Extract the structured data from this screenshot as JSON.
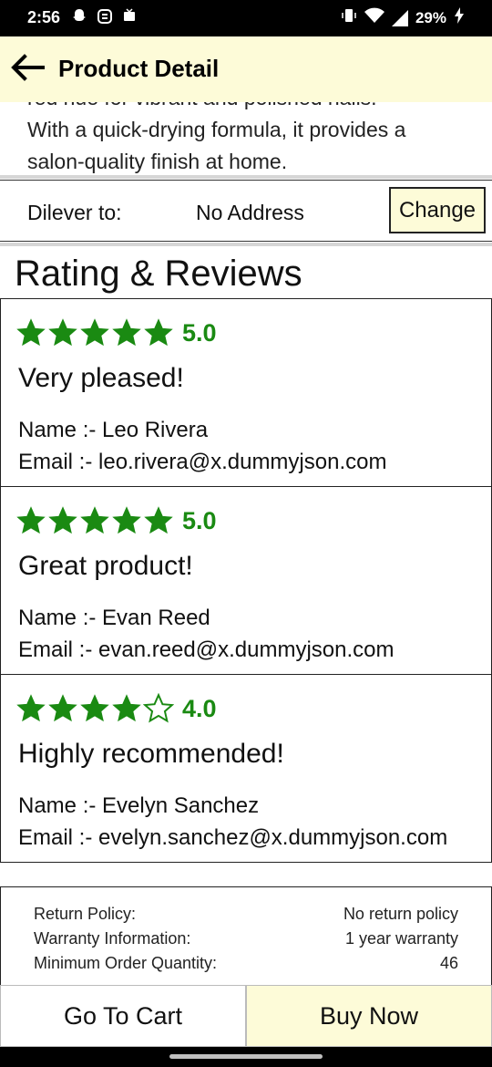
{
  "status_bar": {
    "time": "2:56",
    "battery": "29%",
    "left_icons": [
      "snapchat-icon",
      "app-icon",
      "photo-icon"
    ],
    "right_icons": [
      "vibrate-icon",
      "wifi-icon",
      "signal-icon",
      "charging-icon"
    ]
  },
  "app_bar": {
    "title": "Product Detail",
    "back_icon": "arrow-left-icon"
  },
  "product": {
    "description_line1": "red hue for vibrant and polished nails.",
    "description_line2": "With a quick-drying formula, it provides a",
    "description_line3": "salon-quality finish at home."
  },
  "delivery": {
    "label": "Dilever to:",
    "address": "No Address",
    "change_label": "Change"
  },
  "reviews": {
    "heading": "Rating & Reviews",
    "star_color": "#1a8a12",
    "items": [
      {
        "stars": 5,
        "rating": "5.0",
        "comment": "Very pleased!",
        "name": "Name :- Leo Rivera",
        "email": "Email :- leo.rivera@x.dummyjson.com"
      },
      {
        "stars": 5,
        "rating": "5.0",
        "comment": "Great product!",
        "name": "Name :- Evan Reed",
        "email": "Email :- evan.reed@x.dummyjson.com"
      },
      {
        "stars": 4,
        "rating": "4.0",
        "comment": "Highly recommended!",
        "name": "Name :- Evelyn Sanchez",
        "email": "Email :- evelyn.sanchez@x.dummyjson.com"
      }
    ]
  },
  "policy": {
    "return_label": "Return Policy:",
    "return_value": "No return policy",
    "warranty_label": "Warranty Information:",
    "warranty_value": "1 year warranty",
    "min_order_label": "Minimum Order Quantity:",
    "min_order_value": "46"
  },
  "actions": {
    "go_to_cart": "Go To Cart",
    "buy_now": "Buy Now"
  },
  "colors": {
    "app_bar_bg": "#fdfbd8",
    "accent_green": "#1a8a12"
  }
}
